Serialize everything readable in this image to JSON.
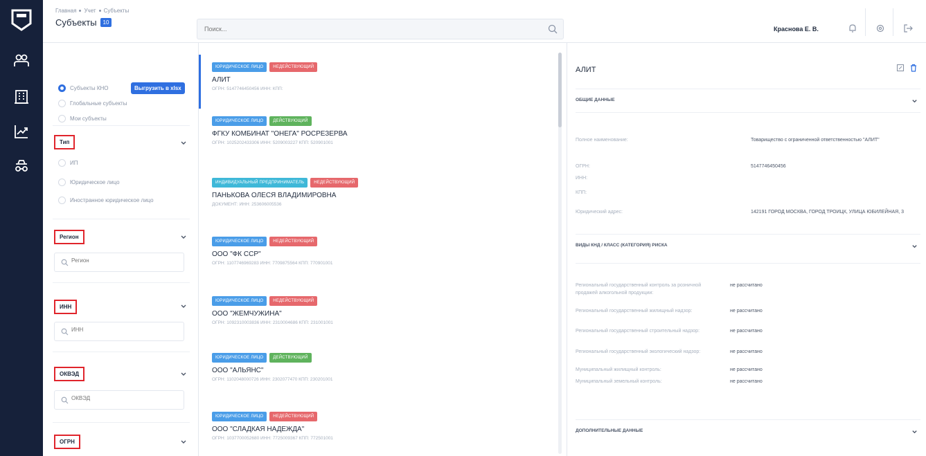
{
  "header": {
    "breadcrumb": [
      "Главная",
      "Учет",
      "Субъекты"
    ],
    "title": "Субъекты",
    "count": "10",
    "search_placeholder": "Поиск...",
    "user": "Краснова Е. В."
  },
  "filters": {
    "radios": [
      {
        "label": "Субъекты КНО",
        "checked": true
      },
      {
        "label": "Глобальные субъекты",
        "checked": false
      },
      {
        "label": "Мои субъекты",
        "checked": false
      }
    ],
    "export_label": "Выгрузить в xlsx",
    "type": {
      "title": "Тип",
      "options": [
        "ИП",
        "Юридическое лицо",
        "Иностранное юридическое лицо"
      ]
    },
    "region": {
      "title": "Регион",
      "placeholder": "Регион"
    },
    "inn": {
      "title": "ИНН",
      "placeholder": "ИНН"
    },
    "okved": {
      "title": "ОКВЭД",
      "placeholder": "ОКВЭД"
    },
    "ogrn": {
      "title": "ОГРН"
    }
  },
  "list": [
    {
      "tags": [
        {
          "text": "Юридическое лицо",
          "color": "blue"
        },
        {
          "text": "Недействующий",
          "color": "red"
        }
      ],
      "name": "АЛИТ",
      "meta": "ОГРН: 5147746450456   ИНН:   КПП:"
    },
    {
      "tags": [
        {
          "text": "Юридическое лицо",
          "color": "blue"
        },
        {
          "text": "Действующий",
          "color": "green"
        }
      ],
      "name": "ФГКУ КОМБИНАТ \"ОНЕГА\" РОСРЕЗЕРВА",
      "meta": "ОГРН: 1025202433306   ИНН: 5209003227   КПП: 520901001"
    },
    {
      "tags": [
        {
          "text": "Индивидуальный предприниматель",
          "color": "teal"
        },
        {
          "text": "Недействующий",
          "color": "red"
        }
      ],
      "name": "ПАНЬКОВА ОЛЕСЯ ВЛАДИМИРОВНА",
      "meta": "ДОКУМЕНТ: ИНН: 253606005536"
    },
    {
      "tags": [
        {
          "text": "Юридическое лицо",
          "color": "blue"
        },
        {
          "text": "Недействующий",
          "color": "red"
        }
      ],
      "name": "ООО \"ФК ССР\"",
      "meta": "ОГРН: 1107746969283   ИНН: 7709875564   КПП: 770901001"
    },
    {
      "tags": [
        {
          "text": "Юридическое лицо",
          "color": "blue"
        },
        {
          "text": "Недействующий",
          "color": "red"
        }
      ],
      "name": "ООО \"ЖЕМЧУЖИНА\"",
      "meta": "ОГРН: 1092310003836   ИНН: 2310004686   КПП: 231001001"
    },
    {
      "tags": [
        {
          "text": "Юридическое лицо",
          "color": "blue"
        },
        {
          "text": "Действующий",
          "color": "green"
        }
      ],
      "name": "ООО \"АЛЬЯНС\"",
      "meta": "ОГРН: 1102048000726   ИНН: 2302077470   КПП: 230201001"
    },
    {
      "tags": [
        {
          "text": "Юридическое лицо",
          "color": "blue"
        },
        {
          "text": "Недействующий",
          "color": "red"
        }
      ],
      "name": "ООО \"СЛАДКАЯ НАДЕЖДА\"",
      "meta": "ОГРН: 1037700052680   ИНН: 7725009367   КПП: 772501001"
    }
  ],
  "detail": {
    "title": "АЛИТ",
    "sections": [
      "Общие данные",
      "Виды КНД / Класс (категория) риска",
      "Дополнительные данные"
    ],
    "general": [
      {
        "label": "Полное наименование:",
        "value": "Товарищество с ограниченной ответственностью \"АЛИТ\""
      },
      {
        "label": "ОГРН:",
        "value": "5147746450456"
      },
      {
        "label": "ИНН:",
        "value": ""
      },
      {
        "label": "КПП:",
        "value": ""
      },
      {
        "label": "Юридический адрес:",
        "value": "142191 ГОРОД МОСКВА, ГОРОД ТРОИЦК, УЛИЦА ЮБИЛЕЙНАЯ, 3"
      }
    ],
    "risk": [
      {
        "label": "Региональный государственный контроль за розничной продажей алкогольной продукции:",
        "value": "не рассчитано"
      },
      {
        "label": "Региональный государственный жилищный надзор:",
        "value": "не рассчитано"
      },
      {
        "label": "Региональный государственный строительный надзор:",
        "value": "не рассчитано"
      },
      {
        "label": "Региональный государственный экологический надзор:",
        "value": "не рассчитано"
      },
      {
        "label": "Муниципальный жилищный контроль:",
        "value": "не рассчитано"
      },
      {
        "label": "Муниципальный земельный контроль:",
        "value": "не рассчитано"
      }
    ]
  },
  "colors": {
    "accent": "#2f6fe0",
    "rail": "#16213a",
    "highlight": "#e0242b"
  }
}
